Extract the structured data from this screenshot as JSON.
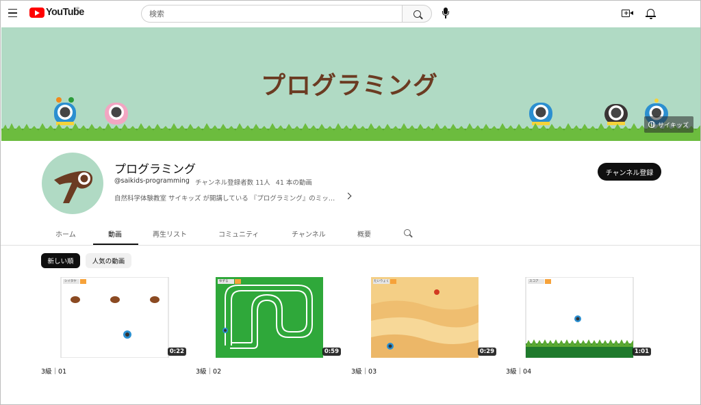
{
  "topbar": {
    "logo_text": "YouTube",
    "region": "JP",
    "search_placeholder": "検索"
  },
  "banner": {
    "title": "プログラミング",
    "link_label": "サイキッズ"
  },
  "channel": {
    "name": "プログラミング",
    "handle": "@saikids-programming",
    "subscribers": "チャンネル登録者数 11人",
    "video_count": "41 本の動画",
    "description": "自然科学体験教室 サイキッズ が開講している 『プログラミング』のミッ…",
    "subscribe_label": "チャンネル登録"
  },
  "tabs": [
    {
      "label": "ホーム"
    },
    {
      "label": "動画"
    },
    {
      "label": "再生リスト"
    },
    {
      "label": "コミュニティ"
    },
    {
      "label": "チャンネル"
    },
    {
      "label": "概要"
    }
  ],
  "chips": {
    "selected": "新しい順",
    "other": "人気の動画"
  },
  "videos": [
    {
      "title": "3級｜01",
      "duration": "0:22",
      "thumb_label": "シイタケ"
    },
    {
      "title": "3級｜02",
      "duration": "0:59",
      "thumb_label": "ゆずる"
    },
    {
      "title": "3級｜03",
      "duration": "0:29",
      "thumb_label": "たいりょく"
    },
    {
      "title": "3級｜04",
      "duration": "1:01",
      "thumb_label": "スコア"
    }
  ],
  "colors": {
    "banner_bg": "#b0dac4",
    "title_brown": "#6b3b22",
    "youtube_red": "#ff0000",
    "grass_green": "#5aa832"
  }
}
